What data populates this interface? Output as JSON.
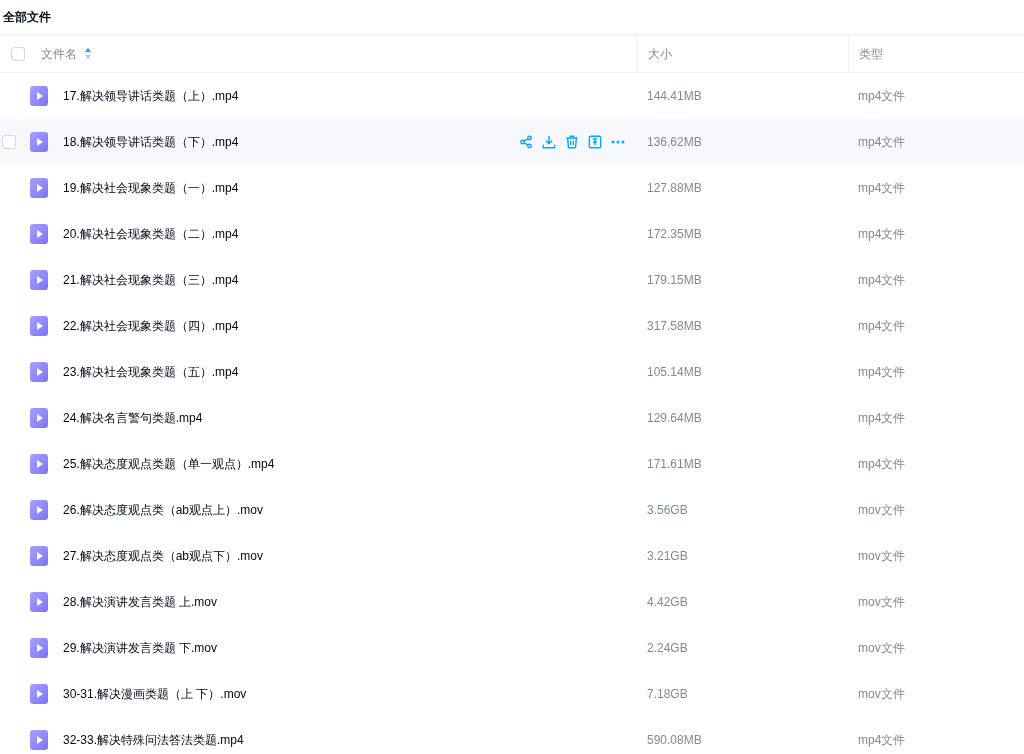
{
  "title": "全部文件",
  "table": {
    "header_checkbox": {
      "checked": false
    },
    "columns": [
      {
        "label": "文件名",
        "sort_ascending": true
      },
      {
        "label": "大小"
      },
      {
        "label": "类型"
      }
    ],
    "rows": [
      {
        "name": "17.解决领导讲话类题（上）.mp4",
        "size": "144.41MB",
        "type": "mp4文件",
        "hovered": false
      },
      {
        "name": "18.解决领导讲话类题（下）.mp4",
        "size": "136.62MB",
        "type": "mp4文件",
        "hovered": true
      },
      {
        "name": "19.解决社会现象类题（一）.mp4",
        "size": "127.88MB",
        "type": "mp4文件",
        "hovered": false
      },
      {
        "name": "20.解决社会现象类题（二）.mp4",
        "size": "172.35MB",
        "type": "mp4文件",
        "hovered": false
      },
      {
        "name": "21.解决社会现象类题（三）.mp4",
        "size": "179.15MB",
        "type": "mp4文件",
        "hovered": false
      },
      {
        "name": "22.解决社会现象类题（四）.mp4",
        "size": "317.58MB",
        "type": "mp4文件",
        "hovered": false
      },
      {
        "name": "23.解决社会现象类题（五）.mp4",
        "size": "105.14MB",
        "type": "mp4文件",
        "hovered": false
      },
      {
        "name": "24.解决名言警句类题.mp4",
        "size": "129.64MB",
        "type": "mp4文件",
        "hovered": false
      },
      {
        "name": "25.解决态度观点类题（单一观点）.mp4",
        "size": "171.61MB",
        "type": "mp4文件",
        "hovered": false
      },
      {
        "name": "26.解决态度观点类（ab观点上）.mov",
        "size": "3.56GB",
        "type": "mov文件",
        "hovered": false
      },
      {
        "name": "27.解决态度观点类（ab观点下）.mov",
        "size": "3.21GB",
        "type": "mov文件",
        "hovered": false
      },
      {
        "name": "28.解决演讲发言类题 上.mov",
        "size": "4.42GB",
        "type": "mov文件",
        "hovered": false
      },
      {
        "name": "29.解决演讲发言类题 下.mov",
        "size": "2.24GB",
        "type": "mov文件",
        "hovered": false
      },
      {
        "name": "30-31.解决漫画类题（上 下）.mov",
        "size": "7.18GB",
        "type": "mov文件",
        "hovered": false
      },
      {
        "name": "32-33.解决特殊问法答法类题.mp4",
        "size": "590.08MB",
        "type": "mp4文件",
        "hovered": false
      }
    ]
  }
}
